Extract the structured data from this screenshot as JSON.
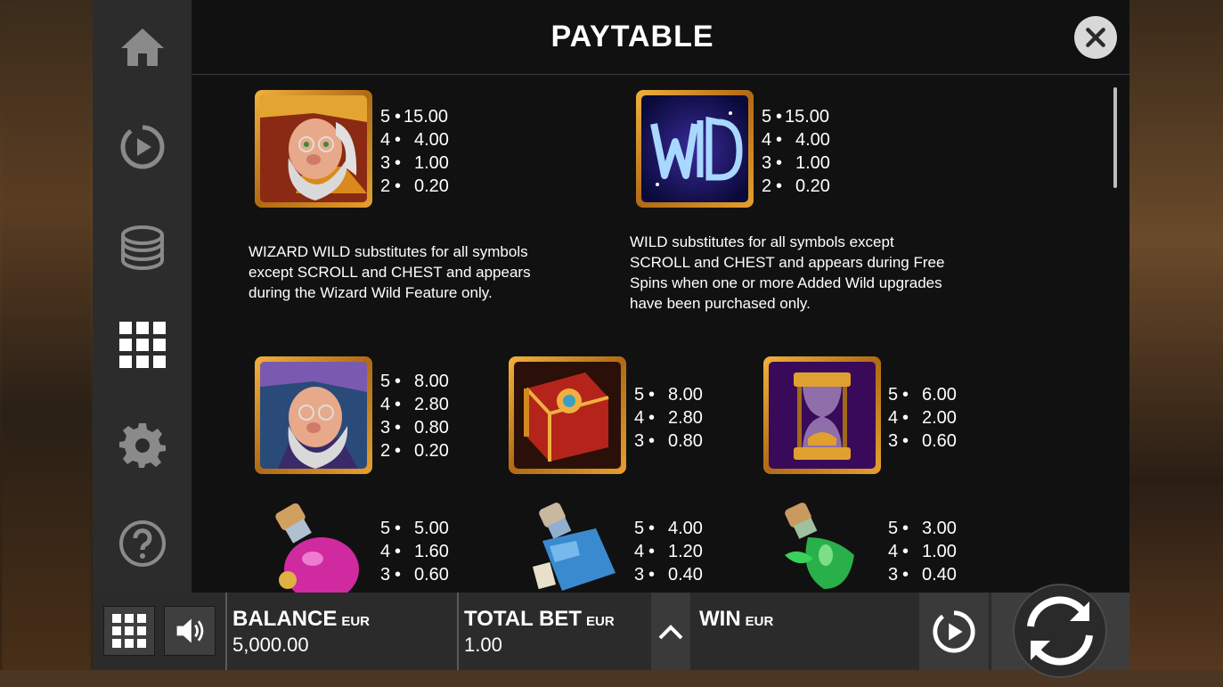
{
  "header": {
    "title": "PAYTABLE"
  },
  "sidebar": {
    "items": [
      {
        "icon": "home-icon"
      },
      {
        "icon": "autoplay-icon"
      },
      {
        "icon": "coins-icon"
      },
      {
        "icon": "paytable-grid-icon",
        "active": true
      },
      {
        "icon": "gear-icon"
      },
      {
        "icon": "help-icon"
      }
    ]
  },
  "symbols": [
    {
      "name": "wizard-gold",
      "pays": [
        [
          "5",
          "15.00"
        ],
        [
          "4",
          "4.00"
        ],
        [
          "3",
          "1.00"
        ],
        [
          "2",
          "0.20"
        ]
      ]
    },
    {
      "name": "wild",
      "pays": [
        [
          "5",
          "15.00"
        ],
        [
          "4",
          "4.00"
        ],
        [
          "3",
          "1.00"
        ],
        [
          "2",
          "0.20"
        ]
      ]
    },
    {
      "name": "wizard-blue",
      "pays": [
        [
          "5",
          "8.00"
        ],
        [
          "4",
          "2.80"
        ],
        [
          "3",
          "0.80"
        ],
        [
          "2",
          "0.20"
        ]
      ]
    },
    {
      "name": "book",
      "pays": [
        [
          "5",
          "8.00"
        ],
        [
          "4",
          "2.80"
        ],
        [
          "3",
          "0.80"
        ]
      ]
    },
    {
      "name": "hourglass",
      "pays": [
        [
          "5",
          "6.00"
        ],
        [
          "4",
          "2.00"
        ],
        [
          "3",
          "0.60"
        ]
      ]
    },
    {
      "name": "pink-potion",
      "pays": [
        [
          "5",
          "5.00"
        ],
        [
          "4",
          "1.60"
        ],
        [
          "3",
          "0.60"
        ]
      ]
    },
    {
      "name": "blue-potion",
      "pays": [
        [
          "5",
          "4.00"
        ],
        [
          "4",
          "1.20"
        ],
        [
          "3",
          "0.40"
        ]
      ]
    },
    {
      "name": "green-potion",
      "pays": [
        [
          "5",
          "3.00"
        ],
        [
          "4",
          "1.00"
        ],
        [
          "3",
          "0.40"
        ]
      ]
    }
  ],
  "descriptions": {
    "wizard_wild": [
      "WIZARD WILD substitutes for all symbols",
      "except SCROLL and CHEST and appears",
      "during the Wizard Wild Feature only."
    ],
    "wild": [
      "WILD substitutes for all symbols except",
      "SCROLL and CHEST and appears during Free",
      "Spins when one or more Added Wild upgrades",
      "have been purchased only."
    ]
  },
  "bottombar": {
    "balance_label": "BALANCE",
    "balance_currency": "EUR",
    "balance_value": "5,000.00",
    "totalbet_label": "TOTAL BET",
    "totalbet_currency": "EUR",
    "totalbet_value": "1.00",
    "win_label": "WIN",
    "win_currency": "EUR"
  },
  "colors": {
    "panel_bg": "#111111",
    "sidebar_bg": "#2c2c2c",
    "icon_grey": "#8a8a8a",
    "icon_active": "#ffffff",
    "frame_gold": "#e6a02e"
  }
}
